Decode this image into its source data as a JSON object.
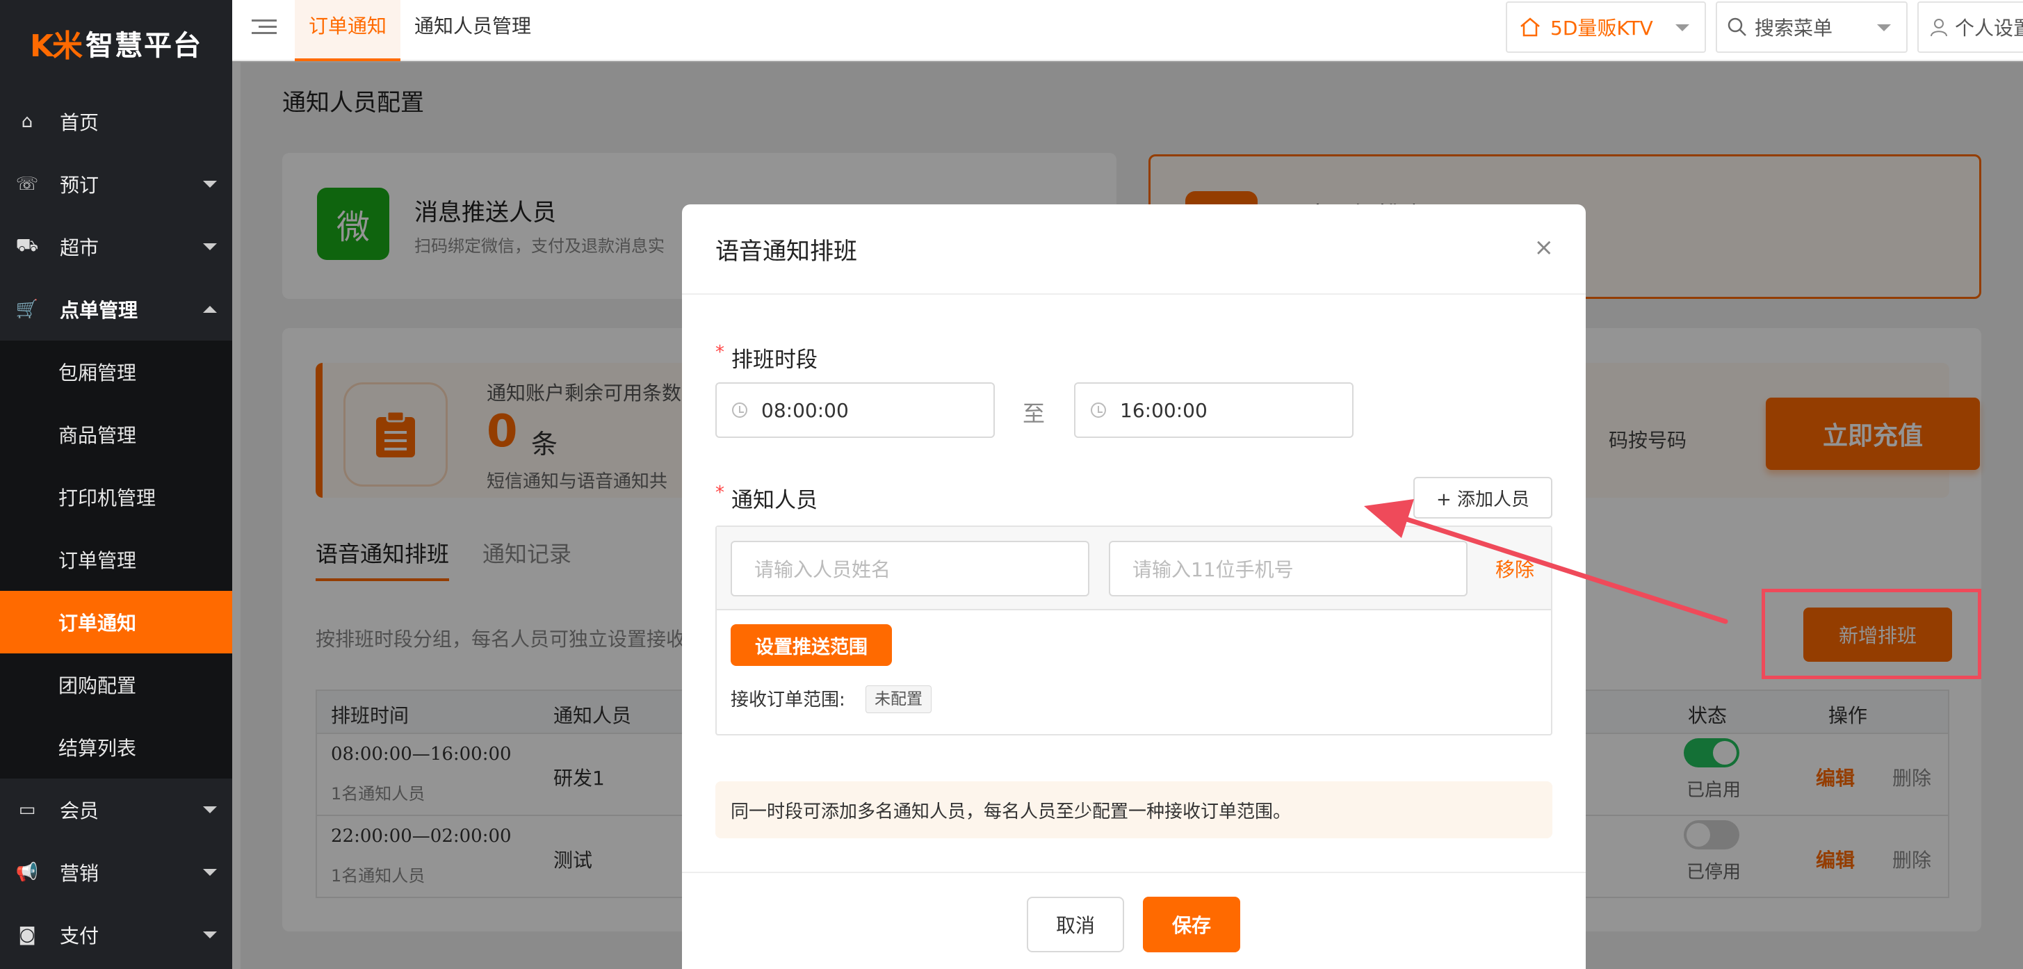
{
  "logo": {
    "mark": "K米",
    "text": "智慧平台"
  },
  "sidebar": {
    "items": [
      {
        "icon": "home-icon",
        "glyph": "⌂",
        "label": "首页"
      },
      {
        "icon": "phone-icon",
        "glyph": "☏",
        "label": "预订"
      },
      {
        "icon": "basket-icon",
        "glyph": "⛟",
        "label": "超市"
      },
      {
        "icon": "cart-icon",
        "glyph": "🛒",
        "label": "点单管理"
      },
      {
        "icon": "card-icon",
        "glyph": "▭",
        "label": "会员"
      },
      {
        "icon": "megaphone-icon",
        "glyph": "📢",
        "label": "营销"
      },
      {
        "icon": "money-icon",
        "glyph": "◙",
        "label": "支付"
      }
    ],
    "subitems": [
      "包厢管理",
      "商品管理",
      "打印机管理",
      "订单管理",
      "订单通知",
      "团购配置",
      "结算列表"
    ]
  },
  "topbar": {
    "tabs": [
      "订单通知",
      "通知人员管理"
    ],
    "store": "5D量贩KTV",
    "search": "搜索菜单",
    "profile": "个人设置"
  },
  "page": {
    "title": "通知人员配置",
    "wx_glyph": "微",
    "push_title": "消息推送人员",
    "push_desc": "扫码绑定微信，支付及退款消息实",
    "voice_card_title": "语音通知排班",
    "remain_label": "通知账户剩余可用条数",
    "remain_value": "0",
    "remain_unit": "条",
    "remain_desc": "短信通知与语音通知共",
    "dial_hint": "码按号码",
    "recharge": "立即充值",
    "tabs": [
      "语音通知排班",
      "通知记录"
    ],
    "group_desc": "按排班时段分组，每名人员可独立设置接收",
    "add_shift": "新增排班",
    "table": {
      "headers": [
        "排班时间",
        "通知人员",
        "状态",
        "操作"
      ],
      "rows": [
        {
          "time": "08:00:00—16:00:00",
          "count": "1名通知人员",
          "person": "研发1",
          "status": "已启用",
          "on": true,
          "edit": "编辑",
          "del": "删除"
        },
        {
          "time": "22:00:00—02:00:00",
          "count": "1名通知人员",
          "person": "测试",
          "status": "已停用",
          "on": false,
          "edit": "编辑",
          "del": "删除"
        }
      ]
    }
  },
  "modal": {
    "title": "语音通知排班",
    "close": "×",
    "required_mark": "*",
    "shift_label": "排班时段",
    "start": "08:00:00",
    "to": "至",
    "end": "16:00:00",
    "people_label": "通知人员",
    "add_person": "+ 添加人员",
    "name_placeholder": "请输入人员姓名",
    "phone_placeholder": "请输入11位手机号",
    "remove": "移除",
    "push_range_btn": "设置推送范围",
    "range_label": "接收订单范围:",
    "range_tag": "未配置",
    "tip": "同一时段可添加多名通知人员，每名人员至少配置一种接收订单范围。",
    "cancel": "取消",
    "save": "保存"
  },
  "colors": {
    "accent": "#ff6a00",
    "sidebar_bg": "#202226",
    "wechat": "#1aad19",
    "annotation": "#ef4a5a"
  }
}
